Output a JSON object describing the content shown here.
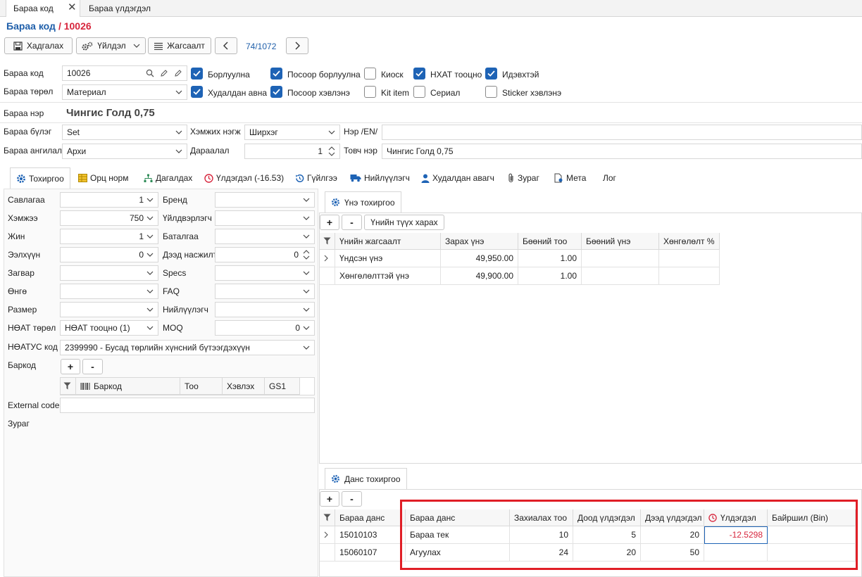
{
  "tabs": [
    {
      "label": "Бараа код"
    },
    {
      "label": "Бараа үлдэгдэл"
    }
  ],
  "title": {
    "label": "Бараа код",
    "code": "/ 10026"
  },
  "toolbar": {
    "save": "Хадгалах",
    "action": "Үйлдэл",
    "list": "Жагсаалт",
    "pager": "74/1072"
  },
  "form": {
    "code_label": "Бараа код",
    "code_value": "10026",
    "type_label": "Бараа төрөл",
    "type_value": "Материал",
    "name_label": "Бараа нэр",
    "name_value": "Чингис Голд 0,75",
    "group_label": "Бараа бүлэг",
    "group_value": "Set",
    "unit_label": "Хэмжих нэгж",
    "unit_value": "Ширхэг",
    "name_en_label": "Нэр /EN/",
    "name_en_value": "",
    "class_label": "Бараа ангилал",
    "class_value": "Архи",
    "order_label": "Дараалал",
    "order_value": "1",
    "short_label": "Товч нэр",
    "short_value": "Чингис Голд 0,75"
  },
  "checks": [
    {
      "label": "Борлуулна",
      "checked": true
    },
    {
      "label": "Посоор борлуулна",
      "checked": true
    },
    {
      "label": "Киоск",
      "checked": false
    },
    {
      "label": "НХАТ тооцно",
      "checked": true
    },
    {
      "label": "Идэвхтэй",
      "checked": true
    },
    {
      "label": "Худалдан авна",
      "checked": true
    },
    {
      "label": "Посоор хэвлэнэ",
      "checked": true
    },
    {
      "label": "Kit item",
      "checked": false
    },
    {
      "label": "Сериал",
      "checked": false
    },
    {
      "label": "Sticker хэвлэнэ",
      "checked": false
    }
  ],
  "navtabs": [
    {
      "label": "Тохиргоо",
      "icon": "gear-icon"
    },
    {
      "label": "Орц норм",
      "icon": "table-icon"
    },
    {
      "label": "Дагалдах",
      "icon": "tree-icon"
    },
    {
      "label": "Үлдэгдэл (-16.53)",
      "icon": "clock-icon"
    },
    {
      "label": "Гүйлгээ",
      "icon": "history-icon"
    },
    {
      "label": "Нийлүүлэгч",
      "icon": "truck-icon"
    },
    {
      "label": "Худалдан авагч",
      "icon": "user-icon"
    },
    {
      "label": "Зураг",
      "icon": "paperclip-icon"
    },
    {
      "label": "Мета",
      "icon": "meta-icon"
    },
    {
      "label": "Лог",
      "icon": ""
    }
  ],
  "settings": {
    "left": [
      {
        "label": "Савлагаа",
        "value": "1",
        "kind": "num"
      },
      {
        "label": "Хэмжээ",
        "value": "750",
        "kind": "num"
      },
      {
        "label": "Жин",
        "value": "1",
        "kind": "num"
      },
      {
        "label": "Ээлхүүн",
        "value": "0",
        "kind": "num"
      },
      {
        "label": "Загвар",
        "value": "",
        "kind": "dd"
      },
      {
        "label": "Өнгө",
        "value": "",
        "kind": "dd"
      },
      {
        "label": "Размер",
        "value": "",
        "kind": "dd"
      },
      {
        "label": "НӨАТ төрөл",
        "value": "НӨАТ тооцно (1)",
        "kind": "dd"
      }
    ],
    "right": [
      {
        "label": "Бренд",
        "value": "",
        "kind": "dd"
      },
      {
        "label": "Үйлдвэрлэгч",
        "value": "",
        "kind": "dd"
      },
      {
        "label": "Баталгаа",
        "value": "",
        "kind": "dd"
      },
      {
        "label": "Дээд насжилт",
        "value": "0",
        "kind": "spin"
      },
      {
        "label": "Specs",
        "value": "",
        "kind": "dd"
      },
      {
        "label": "FAQ",
        "value": "",
        "kind": "dd"
      },
      {
        "label": "Нийлүүлэгч",
        "value": "",
        "kind": "dd"
      },
      {
        "label": "MOQ",
        "value": "0",
        "kind": "num"
      }
    ],
    "tax_label": "НӨАТУС код",
    "tax_value": "2399990 - Бусад төрлийн хүнсний бүтээгдэхүүн",
    "barcode_label": "Баркод",
    "barcode_cols": [
      "Баркод",
      "Тоо",
      "Хэвлэх",
      "GS1"
    ],
    "external_label": "External code",
    "external_value": "",
    "image_label": "Зураг"
  },
  "price": {
    "tab": "Үнэ тохиргоо",
    "add": "+",
    "remove": "-",
    "history": "Үнийн түүх харах",
    "cols": [
      "Үнийн жагсаалт",
      "Зарах үнэ",
      "Бөөний тоо",
      "Бөөний үнэ",
      "Хөнгөлөлт %"
    ],
    "rows": [
      [
        "Үндсэн үнэ",
        "49,950.00",
        "1.00",
        "",
        ""
      ],
      [
        "Хөнгөлөлттэй үнэ",
        "49,900.00",
        "1.00",
        "",
        ""
      ]
    ]
  },
  "account": {
    "tab": "Данс тохиргоо",
    "add": "+",
    "remove": "-",
    "cols": [
      "Бараа данс",
      "Бараа данс",
      "Захиалах тоо",
      "Доод үлдэгдэл",
      "Дээд үлдэгдэл",
      "Үлдэгдэл",
      "Байршил (Bin)"
    ],
    "rows": [
      [
        "15010103",
        "Бараа тек",
        "10",
        "5",
        "20",
        "-12.5298",
        ""
      ],
      [
        "15060107",
        "Агуулах",
        "24",
        "20",
        "50",
        "",
        ""
      ]
    ]
  }
}
